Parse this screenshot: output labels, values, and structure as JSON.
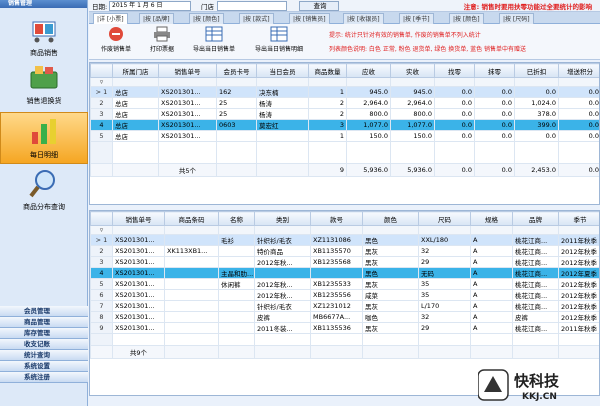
{
  "sidebar": {
    "header": "销售管理",
    "items": [
      {
        "label": "商品销售",
        "icon": "cart-icon"
      },
      {
        "label": "销售退换货",
        "icon": "basket-icon"
      },
      {
        "label": "每日明细",
        "icon": "bar-chart-icon"
      },
      {
        "label": "商品分布查询",
        "icon": "magnifier-icon"
      }
    ],
    "bottom": [
      "会员管理",
      "商品管理",
      "库存管理",
      "收支记账",
      "统计查询",
      "系统设置",
      "系统注册"
    ]
  },
  "topbar": {
    "date_label": "日期:",
    "date_value": "2015 年 1 月 6 日",
    "store_label": "门店",
    "query_label": "查询",
    "notice": "注意: 销售时要用扶零功能过全要统计的影响"
  },
  "tabs": [
    "|详 [小票]",
    "|按 [品牌]",
    "|按 [颜色]",
    "|按 [款式]",
    "|按 [销售员]",
    "|按 [收银员]",
    "|按 [季节]",
    "|按 [颜色]",
    "|按 [尺码]"
  ],
  "toolbar": {
    "buttons": [
      "作废销售单",
      "打印票据",
      "导出当日销售单",
      "导出当日销售明细"
    ],
    "hint1": "提示: 统计只针对有效的销售单, 作废的销售单不列入统计",
    "hint2": "列表颜色说明: 白色 正常, 粉色 退货单, 绿色 换货单, 蓝色 销售单中有赠送"
  },
  "top_grid": {
    "columns": [
      "",
      "所属门店",
      "销售单号",
      "会员卡号",
      "当日会员",
      "商品数量",
      "应收",
      "实收",
      "找零",
      "抹零",
      "已折扣",
      "增送积分"
    ],
    "rows": [
      {
        "rn": "> 1",
        "store": "总店",
        "no": "XS201301...",
        "card": "162",
        "member": "决东楠",
        "qty": "1",
        "due": "945.0",
        "paid": "945.0",
        "change": "0.0",
        "wipe": "0.0",
        "disc": "0.0",
        "points": "0.0"
      },
      {
        "rn": "2",
        "store": "总店",
        "no": "XS201301...",
        "card": "25",
        "member": "杨涛",
        "qty": "2",
        "due": "2,964.0",
        "paid": "2,964.0",
        "change": "0.0",
        "wipe": "0.0",
        "disc": "1,024.0",
        "points": "0.0"
      },
      {
        "rn": "3",
        "store": "总店",
        "no": "XS201301...",
        "card": "25",
        "member": "杨涛",
        "qty": "2",
        "due": "800.0",
        "paid": "800.0",
        "change": "0.0",
        "wipe": "0.0",
        "disc": "378.0",
        "points": "0.0"
      },
      {
        "rn": "4",
        "store": "总店",
        "no": "XS201301...",
        "card": "0603",
        "member": "莫宏红",
        "qty": "3",
        "due": "1,077.0",
        "paid": "1,077.0",
        "change": "0.0",
        "wipe": "0.0",
        "disc": "399.0",
        "points": "0.0"
      },
      {
        "rn": "5",
        "store": "总店",
        "no": "XS201301...",
        "card": "",
        "member": "",
        "qty": "1",
        "due": "150.0",
        "paid": "150.0",
        "change": "0.0",
        "wipe": "0.0",
        "disc": "0.0",
        "points": "0.0"
      }
    ],
    "summary": {
      "count": "共5个",
      "qty": "9",
      "due": "5,936.0",
      "paid": "5,936.0",
      "change": "0.0",
      "wipe": "0.0",
      "disc": "2,453.0",
      "points": "0.0"
    }
  },
  "bottom_grid": {
    "columns": [
      "",
      "销售单号",
      "商品条码",
      "名称",
      "类别",
      "款号",
      "颜色",
      "尺码",
      "规格",
      "品牌",
      "季节"
    ],
    "rows": [
      {
        "rn": "> 1",
        "no": "XS201301...",
        "code": "",
        "name": "毛衫",
        "cat": "针织衫/毛衣",
        "style": "XZ1131086",
        "color": "黑色",
        "size": "XXL/180",
        "spec": "A",
        "brand": "桃花江商...",
        "season": "2011年秋季"
      },
      {
        "rn": "2",
        "no": "XS201301...",
        "code": "XK113XB1...",
        "name": "",
        "cat": "特价商品",
        "style": "XB1135570",
        "color": "黑灰",
        "size": "32",
        "spec": "A",
        "brand": "桃花江商...",
        "season": "2012年秋季"
      },
      {
        "rn": "3",
        "no": "XS201301...",
        "code": "",
        "name": "",
        "cat": "2012年秋...",
        "style": "XB1235568",
        "color": "黑灰",
        "size": "29",
        "spec": "A",
        "brand": "桃花江商...",
        "season": "2012年秋季"
      },
      {
        "rn": "4",
        "no": "XS201301...",
        "code": "",
        "name": "主晶和肋...",
        "cat": "",
        "style": "",
        "color": "黑色",
        "size": "无码",
        "spec": "A",
        "brand": "桃花江商...",
        "season": "2012年夏季"
      },
      {
        "rn": "5",
        "no": "XS201301...",
        "code": "",
        "name": "休闲裤",
        "cat": "2012年秋...",
        "style": "XB1235533",
        "color": "黑灰",
        "size": "35",
        "spec": "A",
        "brand": "桃花江商...",
        "season": "2012年秋季"
      },
      {
        "rn": "6",
        "no": "XS201301...",
        "code": "",
        "name": "",
        "cat": "2012年秋...",
        "style": "XB1235556",
        "color": "咸菜",
        "size": "35",
        "spec": "A",
        "brand": "桃花江商...",
        "season": "2012年秋季"
      },
      {
        "rn": "7",
        "no": "XS201301...",
        "code": "",
        "name": "",
        "cat": "针织衫/毛衣",
        "style": "XZ1231012",
        "color": "黑灰",
        "size": "L/170",
        "spec": "A",
        "brand": "桃花江商...",
        "season": "2012年秋季"
      },
      {
        "rn": "8",
        "no": "XS201301...",
        "code": "",
        "name": "",
        "cat": "皮裤",
        "style": "MB6677A...",
        "color": "咖色",
        "size": "32",
        "spec": "A",
        "brand": "皮裤",
        "season": "2012年秋季"
      },
      {
        "rn": "9",
        "no": "XS201301...",
        "code": "",
        "name": "",
        "cat": "2011冬装...",
        "style": "XB1135536",
        "color": "黑灰",
        "size": "29",
        "spec": "A",
        "brand": "桃花江商...",
        "season": "2011年秋季"
      }
    ],
    "summary": {
      "count": "共9个"
    }
  },
  "watermark": {
    "cn": "快科技",
    "en": "KKJ.CN"
  }
}
